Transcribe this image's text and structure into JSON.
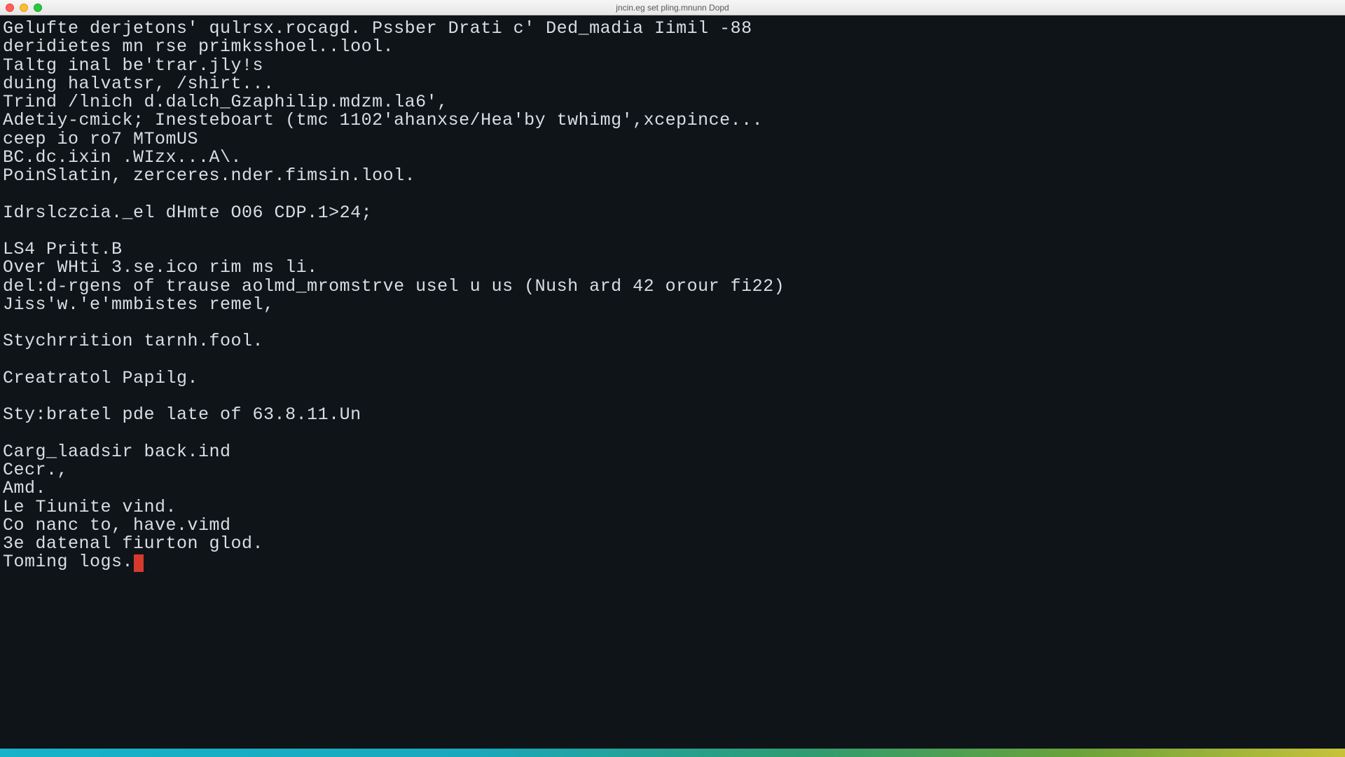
{
  "window": {
    "title": "jncin.eg set pling.mnunn Dopd"
  },
  "terminal": {
    "lines": [
      "Gelufte derjetons' qulrsx.rocagd. Pssber Drati c' Ded_madia Iimil -88",
      "deridietes mn rse primksshoel..lool.",
      "Taltg inal be'trar.jly!s",
      "duing halvatsr, /shirt...",
      "Trind /lnich d.dalch_Gzaphilip.mdzm.la6',",
      "Adetiy-cmick; Inesteboart (tmc 1102'ahanxse/Hea'by twhimg',xcepince...",
      "ceep io ro7 MTomUS",
      "BC.dc.ixin .WIzx...A\\.",
      "PoinSlatin, zerceres.nder.fimsin.lool.",
      "",
      "Idrslczcia._el dHmte O06 CDP.1>24;",
      "",
      "LS4 Pritt.B",
      "Over WHti 3.se.ico rim ms li.",
      "del:d-rgens of trause aolmd_mromstrve usel u us (Nush ard 42 orour fi22)",
      "Jiss'w.'e'mmbistes remel,",
      "",
      "Stychrrition tarnh.fool.",
      "",
      "Creatratol Papilg.",
      "",
      "Sty:bratel pde late of 63.8.11.Un",
      "",
      "Carg_laadsir back.ind",
      "Cecr.,",
      "Amd.",
      "Le Tiunite vind.",
      "Co nanc to, have.vimd",
      "3e datenal fiurton glod.",
      "Toming logs."
    ]
  }
}
